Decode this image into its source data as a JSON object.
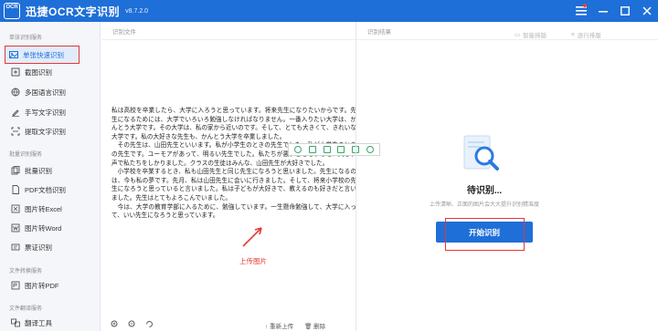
{
  "app": {
    "logo_text": "OCR",
    "title": "迅捷OCR文字识别",
    "version": "v8.7.2.0"
  },
  "sidebar": {
    "sections": [
      {
        "label": "单张识别服务"
      },
      {
        "label": "批量识别服务"
      },
      {
        "label": "文件转换服务"
      },
      {
        "label": "文件翻译服务"
      }
    ],
    "items": [
      {
        "label": "单张快速识别",
        "icon": "photo-icon"
      },
      {
        "label": "截图识别",
        "icon": "screenshot-icon"
      },
      {
        "label": "多国语言识别",
        "icon": "globe-icon"
      },
      {
        "label": "手写文字识别",
        "icon": "handwriting-icon"
      },
      {
        "label": "提取文字识别",
        "icon": "scan-icon"
      },
      {
        "label": "批量识别",
        "icon": "batch-icon"
      },
      {
        "label": "PDF文档识别",
        "icon": "pdf-icon"
      },
      {
        "label": "图片转Excel",
        "icon": "excel-icon"
      },
      {
        "label": "图片转Word",
        "icon": "word-icon"
      },
      {
        "label": "票证识别",
        "icon": "ticket-icon"
      },
      {
        "label": "图片转PDF",
        "icon": "image-pdf-icon"
      },
      {
        "label": "翻译工具",
        "icon": "translate-icon"
      }
    ]
  },
  "left_panel": {
    "header": "识别文件",
    "document": [
      "私は高校を卒業したら、大学に入ろうと思っています。将来先生になりたいからです。先生になるためには、大学でいろいろ勉強しなければなりません。一番入りたい大学は、かんとう大学です。その大学は、私の家から近いのです。そして、とても大きくて、きれいな大学です。私の大好きな先生も、かんとう大学を卒業しました。",
      "その先生は、山田先生といいます。私が小学生のときの先生でした。私が小学生のときの先生です。ユーモアがあって、明るい先生でした。私たちが悪いことをすると、大きい声で私たちをしかりました。クラスの生徒はみんな、山田先生が大好きでした。",
      "小学校を卒業するとき、私も山田先生と同じ先生になろうと思いました。先生になるのは、今も私の夢です。先月、私は山田先生に会いに行きました。そして、将来小学校の先生になろうと思っていると言いました。私は子どもが大好きで、教えるのも好きだと言いました。先生はとてもよろこんでいました。",
      "今は、大学の教育学部に入るために、勉強しています。一生懸命勉強して、大学に入って、いい先生になろうと思っています。"
    ],
    "upload_label": "上传图片",
    "bottom_bar": {
      "zoom_in": "zoom-in-icon",
      "zoom_out": "zoom-out-icon",
      "rotate": "rotate-icon",
      "reupload": "重新上传",
      "delete": "删除"
    }
  },
  "right_panel": {
    "header": "识别结果",
    "btn_layout": "智能排版",
    "btn_paragraph": "逐行排版",
    "wait_title": "待识别...",
    "wait_desc": "上传清晰、正面的图片会大大提升识别精准度",
    "start_button": "开始识别"
  },
  "colors": {
    "brand": "#1e6fd8",
    "highlight": "#e53935",
    "sidebar_bg": "#f4f6f9"
  }
}
